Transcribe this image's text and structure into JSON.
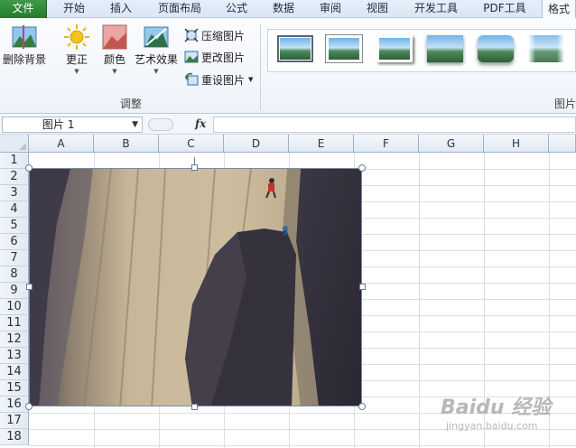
{
  "ribbon_tabs": [
    {
      "label": "文件",
      "type": "file"
    },
    {
      "label": "开始"
    },
    {
      "label": "插入"
    },
    {
      "label": "页面布局"
    },
    {
      "label": "公式"
    },
    {
      "label": "数据"
    },
    {
      "label": "审阅"
    },
    {
      "label": "视图"
    },
    {
      "label": "开发工具"
    },
    {
      "label": "PDF工具"
    },
    {
      "label": "格式",
      "active": true
    }
  ],
  "ribbon": {
    "remove_background": "删除背景",
    "corrections": "更正",
    "color": "颜色",
    "artistic_effects": "艺术效果",
    "compress_pictures": "压缩图片",
    "change_picture": "更改图片",
    "reset_picture": "重设图片",
    "adjust_group": "调整",
    "picture_styles_group": "图片",
    "picture_style_count": 6
  },
  "formula_bar": {
    "name_box": "图片 1",
    "fx_label": "fx",
    "formula_value": ""
  },
  "columns": [
    "A",
    "B",
    "C",
    "D",
    "E",
    "F",
    "G",
    "H"
  ],
  "rows": [
    "1",
    "2",
    "3",
    "4",
    "5",
    "6",
    "7",
    "8",
    "9",
    "10",
    "11",
    "12",
    "13",
    "14",
    "15",
    "16",
    "17",
    "18"
  ],
  "picture": {
    "name": "图片 1",
    "description": "rock climbing photo"
  },
  "watermark": {
    "main": "Baidu 经验",
    "sub": "jingyan.baidu.com"
  },
  "colors": {
    "file_tab": "#2f8a38",
    "accent": "#3a6ea5",
    "rock_light": "#c9b89a",
    "rock_dark": "#3f3a45"
  }
}
